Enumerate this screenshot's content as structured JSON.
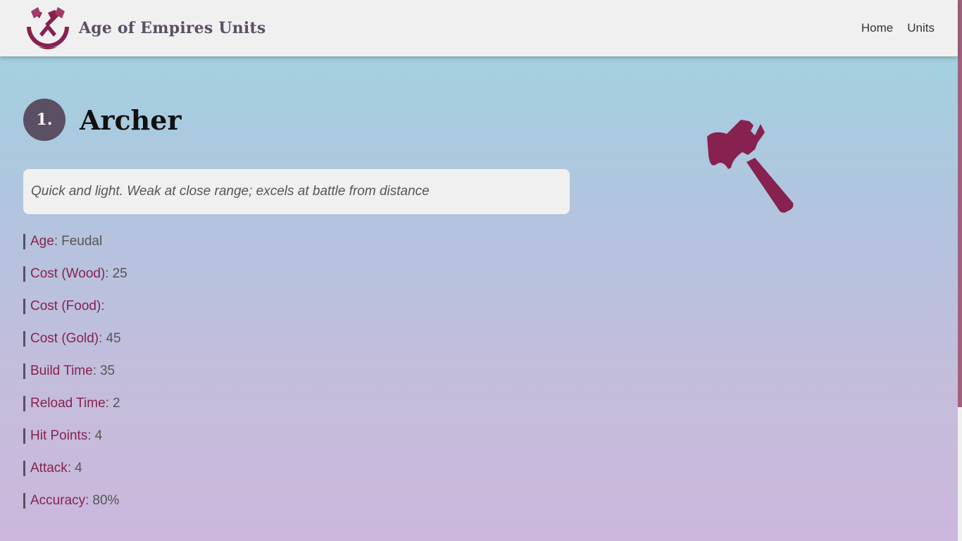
{
  "header": {
    "title": "Age of Empires Units",
    "nav": [
      {
        "label": "Home"
      },
      {
        "label": "Units"
      }
    ]
  },
  "unit": {
    "number": "1.",
    "name": "Archer",
    "description": "Quick and light. Weak at close range; excels at battle from distance",
    "stats": [
      {
        "label": "Age",
        "value": "Feudal"
      },
      {
        "label": "Cost (Wood)",
        "value": "25"
      },
      {
        "label": "Cost (Food)",
        "value": ""
      },
      {
        "label": "Cost (Gold)",
        "value": "45"
      },
      {
        "label": "Build Time",
        "value": "35"
      },
      {
        "label": "Reload Time",
        "value": "2"
      },
      {
        "label": "Hit Points",
        "value": "4"
      },
      {
        "label": "Attack",
        "value": "4"
      },
      {
        "label": "Accuracy",
        "value": "80%"
      }
    ],
    "separator": ":"
  },
  "colors": {
    "accent": "#872150",
    "dark": "#5b4f63",
    "navbar": "#f0f0f0",
    "gradient_top": "#9dd5e0",
    "gradient_bottom": "#cbb8dc"
  },
  "icons": {
    "logo": "crossed-axes-logo-icon",
    "illustration": "axe-icon"
  }
}
